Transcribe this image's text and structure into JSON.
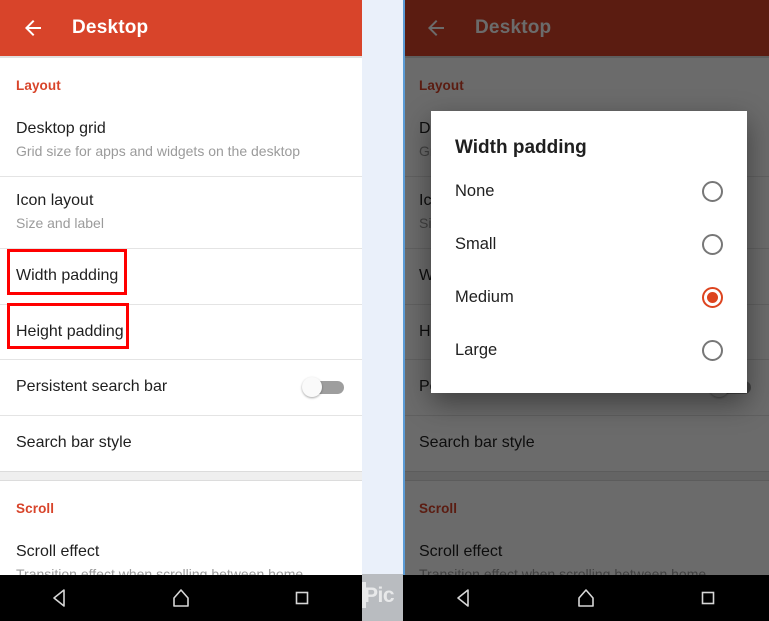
{
  "appbar": {
    "title": "Desktop",
    "back_icon": "arrow-left-icon",
    "bg_color": "#d8442a"
  },
  "sections": [
    {
      "header": "Layout",
      "rows": [
        {
          "title": "Desktop grid",
          "subtitle": "Grid size for apps and widgets on the desktop",
          "control": "none"
        },
        {
          "title": "Icon layout",
          "subtitle": "Size and label",
          "control": "none"
        },
        {
          "title": "Width padding",
          "subtitle": "",
          "control": "none"
        },
        {
          "title": "Height padding",
          "subtitle": "",
          "control": "none"
        },
        {
          "title": "Persistent search bar",
          "subtitle": "",
          "control": "toggle",
          "toggle_on": false
        },
        {
          "title": "Search bar style",
          "subtitle": "",
          "control": "none"
        }
      ]
    },
    {
      "header": "Scroll",
      "rows": [
        {
          "title": "Scroll effect",
          "subtitle": "Transition effect when scrolling between home",
          "control": "none"
        }
      ]
    }
  ],
  "annotations": {
    "color": "#ff0000",
    "boxes": [
      {
        "label": "Width padding"
      },
      {
        "label": "Height padding"
      }
    ]
  },
  "dialog": {
    "title": "Width padding",
    "accent_color": "#dd441f",
    "options": [
      {
        "label": "None",
        "selected": false
      },
      {
        "label": "Small",
        "selected": false
      },
      {
        "label": "Medium",
        "selected": true
      },
      {
        "label": "Large",
        "selected": false
      }
    ]
  },
  "navbar": {
    "back_icon": "triangle-back-icon",
    "home_icon": "home-pentagon-icon",
    "recents_icon": "square-recents-icon"
  },
  "watermark": {
    "text": "Pic"
  }
}
